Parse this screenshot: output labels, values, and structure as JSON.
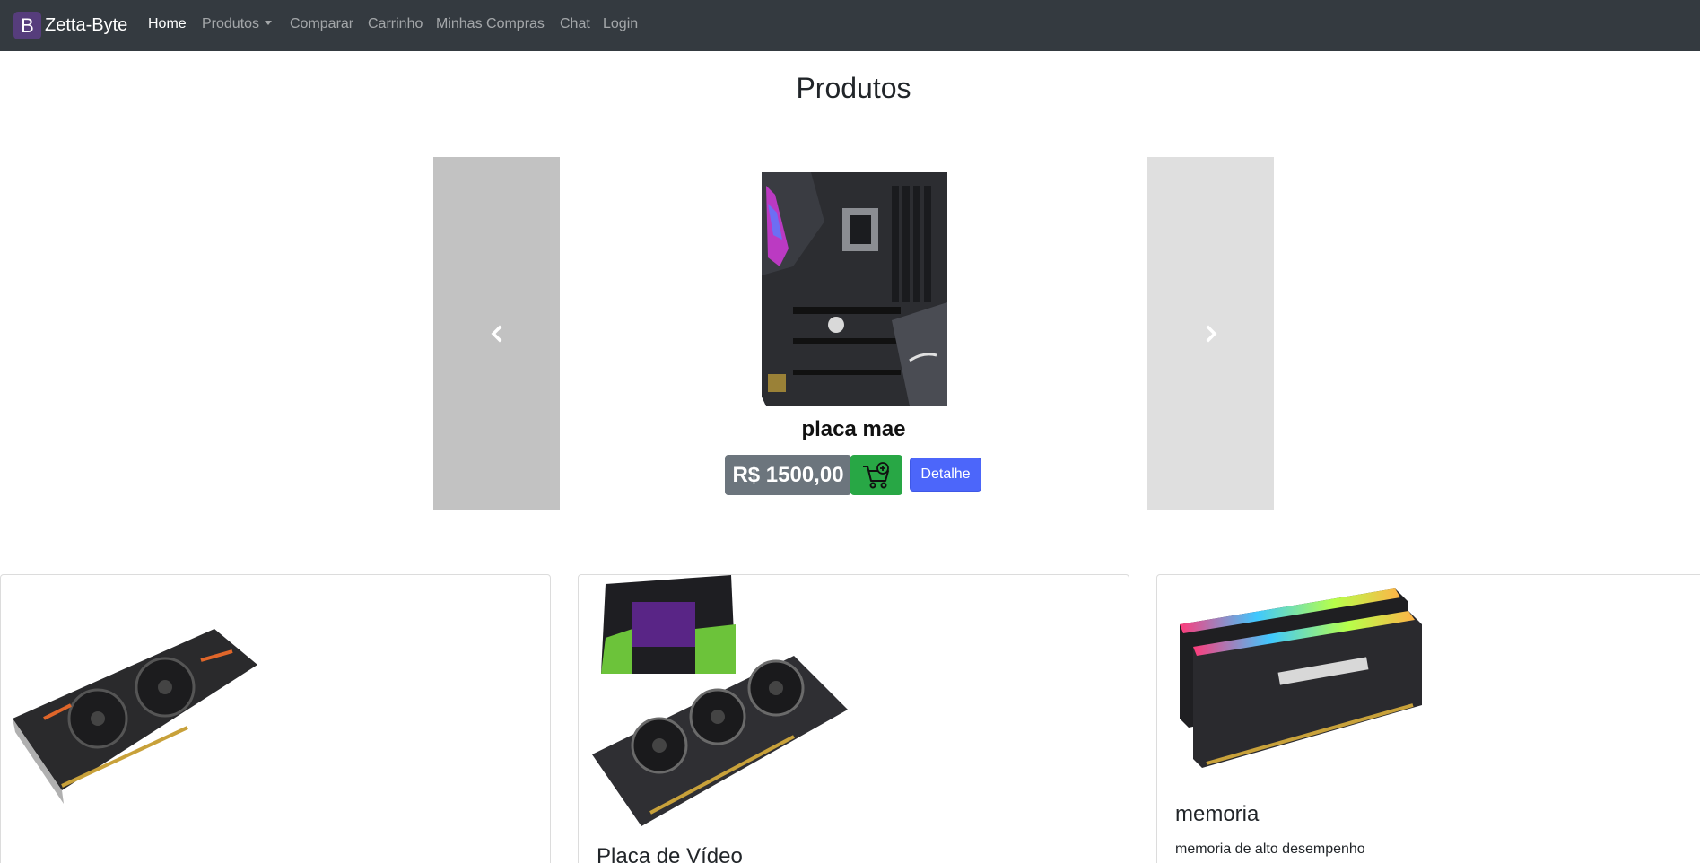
{
  "navbar": {
    "brand_logo": "B",
    "brand_name": "Zetta-Byte",
    "links": [
      {
        "label": "Home",
        "active": true
      },
      {
        "label": "Produtos",
        "dropdown": true
      },
      {
        "label": "Comparar"
      },
      {
        "label": "Carrinho"
      },
      {
        "label": "Minhas Compras"
      },
      {
        "label": "Chat"
      },
      {
        "label": "Login"
      }
    ]
  },
  "page": {
    "title": "Produtos"
  },
  "carousel": {
    "prev_icon": "chevron-left-icon",
    "next_icon": "chevron-right-icon",
    "slide": {
      "image": "motherboard-image",
      "name": "placa mae",
      "price": "R$ 1500,00",
      "cart_icon": "cart-plus-icon",
      "detail_label": "Detalhe"
    }
  },
  "cards": [
    {
      "image": "graphics-card-image",
      "title": "",
      "text": ""
    },
    {
      "image": "rtx-graphics-card-image",
      "title": "Placa de Vídeo",
      "text": ""
    },
    {
      "image": "ram-memory-image",
      "title": "memoria",
      "text": "memoria de alto desempenho"
    }
  ],
  "colors": {
    "navbar_bg": "#343a40",
    "brand_logo_bg": "#563d7c",
    "price_badge_bg": "#6c757d",
    "cart_button_bg": "#28a745",
    "detail_button_bg": "#4c66fa"
  }
}
